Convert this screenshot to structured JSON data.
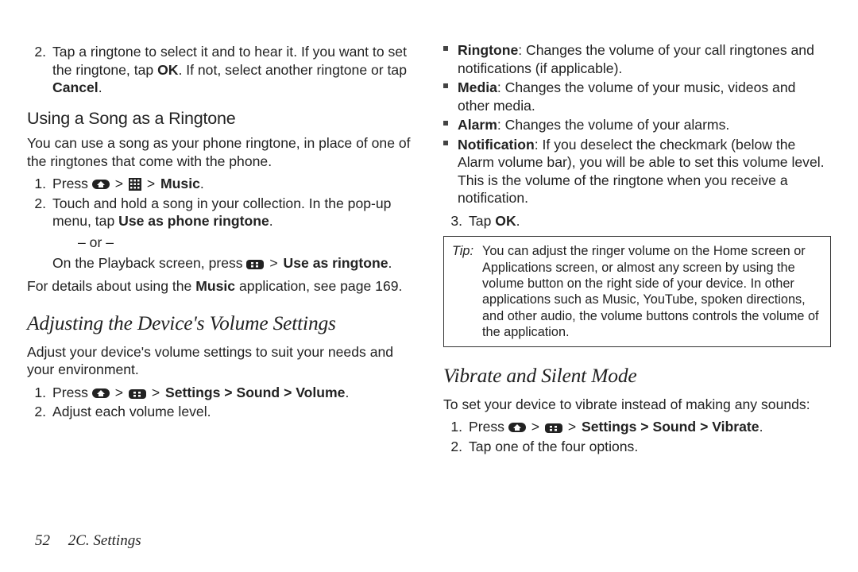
{
  "left": {
    "step2_pre": "Tap a ringtone to select it and to hear it. If you want to set the ringtone, tap ",
    "step2_ok": "OK",
    "step2_mid": ". If not, select another ringtone or tap ",
    "step2_cancel": "Cancel",
    "step2_end": ".",
    "song_head": "Using a Song as a Ringtone",
    "song_intro": "You can use a song as your phone ringtone, in place of one of the ringtones that come with the phone.",
    "song_s1_press": "Press ",
    "song_s1_music": "Music",
    "song_s1_end": ".",
    "song_s2_a": "Touch and hold a song in your collection. In the pop-up menu, tap ",
    "song_s2_b": "Use as phone ringtone",
    "song_s2_c": ".",
    "song_or": "– or –",
    "song_s2_alt_a": "On the Playback screen, press ",
    "song_s2_alt_b": "Use as ringtone",
    "song_s2_alt_c": ".",
    "song_detail_a": "For details about using the ",
    "song_detail_b": "Music",
    "song_detail_c": " application, see page 169.",
    "vol_head": "Adjusting the Device's Volume Settings",
    "vol_intro": "Adjust your device's volume settings to suit your needs and your environment.",
    "vol_s1_press": "Press ",
    "vol_s1_path": "Settings > Sound > Volume",
    "vol_s1_end": ".",
    "vol_s2": "Adjust each volume level."
  },
  "right": {
    "b1_a": "Ringtone",
    "b1_b": ": Changes the volume of your call ringtones and notifications (if applicable).",
    "b2_a": "Media",
    "b2_b": ": Changes the volume of your music, videos and other media.",
    "b3_a": "Alarm",
    "b3_b": ": Changes the volume of your alarms.",
    "b4_a": "Notification",
    "b4_b": ": If you deselect the checkmark (below the Alarm volume bar), you will be able to set this volume level. This is the volume of the ringtone when you receive a notification.",
    "s3_a": "Tap ",
    "s3_b": "OK",
    "s3_c": ".",
    "tip_label": "Tip:",
    "tip_body": "You can adjust the ringer volume on the Home screen or Applications screen, or almost any screen by using the volume button on the right side of your device. In other applications such as Music, YouTube, spoken directions, and other audio, the volume buttons controls the volume of the application.",
    "vib_head": "Vibrate and Silent Mode",
    "vib_intro": "To set your device to vibrate instead of making any sounds:",
    "vib_s1_press": "Press ",
    "vib_s1_path": "Settings > Sound > Vibrate",
    "vib_s1_end": ".",
    "vib_s2": "Tap one of the four options."
  },
  "footer": {
    "page": "52",
    "section": "2C. Settings"
  },
  "num": {
    "n1": "1.",
    "n2": "2.",
    "n3": "3."
  }
}
